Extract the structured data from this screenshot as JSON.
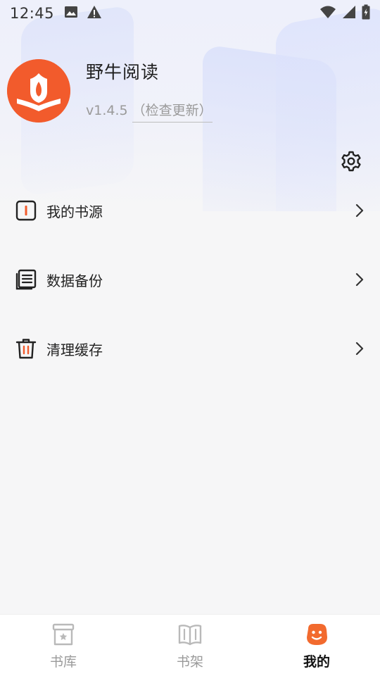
{
  "status_bar": {
    "time": "12:45",
    "left_icons": [
      "image-icon",
      "warning-icon"
    ],
    "right_icons": [
      "wifi-icon",
      "signal-icon",
      "battery-icon"
    ]
  },
  "profile": {
    "app_name": "野牛阅读",
    "version": "v1.4.5",
    "check_update_label": "（检查更新）",
    "avatar_icon": "flame-book-logo",
    "brand_color": "#f25b2c"
  },
  "settings": {
    "icon": "gear-icon"
  },
  "menu": {
    "items": [
      {
        "id": "book-source",
        "label": "我的书源",
        "icon": "book-source-icon"
      },
      {
        "id": "data-backup",
        "label": "数据备份",
        "icon": "backup-icon"
      },
      {
        "id": "clear-cache",
        "label": "清理缓存",
        "icon": "trash-icon"
      }
    ]
  },
  "bottom_nav": {
    "items": [
      {
        "id": "library",
        "label": "书库",
        "icon": "library-icon",
        "active": false
      },
      {
        "id": "bookshelf",
        "label": "书架",
        "icon": "bookshelf-icon",
        "active": false
      },
      {
        "id": "mine",
        "label": "我的",
        "icon": "mine-icon",
        "active": true
      }
    ],
    "active_color": "#f26a2e",
    "inactive_color": "#b9b9b9"
  }
}
